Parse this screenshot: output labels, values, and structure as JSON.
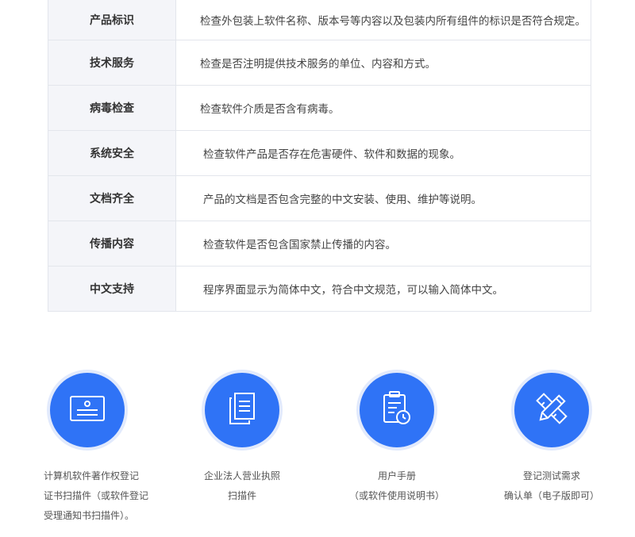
{
  "rows": [
    {
      "label": "产品标识",
      "desc": "检查外包装上软件名称、版本号等内容以及包装内所有组件的标识是否符合规定。"
    },
    {
      "label": "技术服务",
      "desc": "检查是否注明提供技术服务的单位、内容和方式。"
    },
    {
      "label": "病毒检查",
      "desc": "检查软件介质是否含有病毒。"
    },
    {
      "label": "系统安全",
      "desc": "检查软件产品是否存在危害硬件、软件和数据的现象。"
    },
    {
      "label": "文档齐全",
      "desc": "产品的文档是否包含完整的中文安装、使用、维护等说明。"
    },
    {
      "label": "传播内容",
      "desc": "检查软件是否包含国家禁止传播的内容。"
    },
    {
      "label": "中文支持",
      "desc": "程序界面显示为简体中文，符合中文规范，可以输入简体中文。"
    }
  ],
  "items": [
    {
      "icon": "certificate-card-icon",
      "lines": [
        "计算机软件著作权登记",
        "证书扫描件（或软件登记",
        "受理通知书扫描件）。"
      ]
    },
    {
      "icon": "document-copy-icon",
      "lines": [
        "企业法人营业执照",
        "扫描件"
      ]
    },
    {
      "icon": "clipboard-clock-icon",
      "lines": [
        "用户手册",
        "（或软件使用说明书）"
      ]
    },
    {
      "icon": "pencil-ruler-icon",
      "lines": [
        "登记测试需求",
        "确认单（电子版即可）"
      ]
    }
  ],
  "colors": {
    "accent": "#2f73f6",
    "label_bg": "#f4f5f9",
    "border": "#e3e6ec"
  }
}
